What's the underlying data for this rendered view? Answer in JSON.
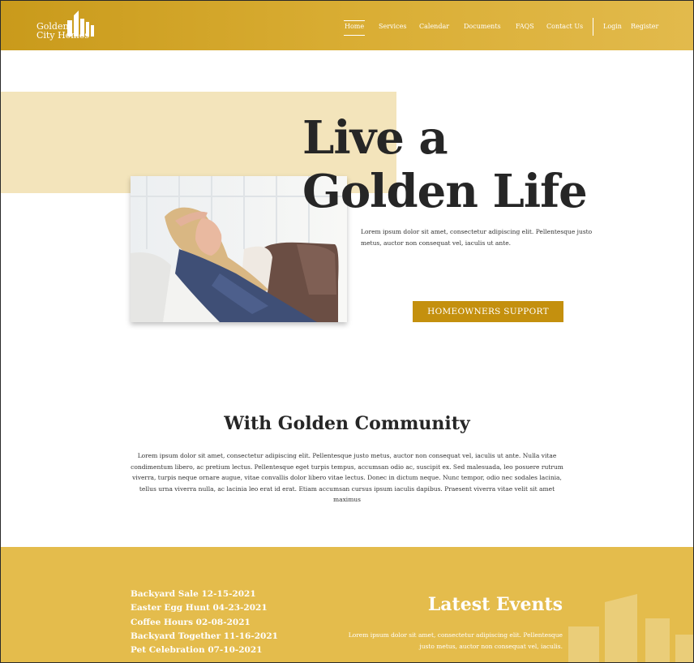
{
  "header": {
    "logo_line1": "Golden",
    "logo_line2": "City Homes",
    "nav": [
      "Home",
      "Services",
      "Calendar",
      "Documents",
      "FAQS",
      "Contact Us"
    ],
    "auth": [
      "Login",
      "Register"
    ]
  },
  "hero": {
    "title_line1": "Live a",
    "title_line2": "Golden Life",
    "text": "Lorem ipsum dolor sit amet, consectetur adipiscing elit. Pellentesque justo metus, auctor non consequat vel, iaculis ut ante.",
    "button": "HOMEOWNERS SUPPORT",
    "photo": "woman-relaxing-on-sofa"
  },
  "community": {
    "title": "With Golden Community",
    "text": "Lorem ipsum dolor sit amet, consectetur adipiscing elit. Pellentesque justo metus, auctor non consequat vel, iaculis ut ante. Nulla vitae condimentum libero, ac pretium lectus. Pellentesque eget turpis tempus, accumsan odio ac, suscipit ex. Sed malesuada, leo posuere rutrum viverra, turpis neque ornare augue, vitae convallis dolor libero vitae lectus. Donec in dictum neque. Nunc tempor, odio nec sodales lacinia, tellus urna viverra nulla, ac lacinia leo erat id erat. Etiam accumsan cursus ipsum iaculis dapibus. Praesent viverra vitae velit sit amet maximus"
  },
  "events": {
    "list": [
      "Backyard Sale 12-15-2021",
      "Easter Egg Hunt 04-23-2021",
      "Coffee Hours 02-08-2021",
      "Backyard Together 11-16-2021",
      "Pet Celebration 07-10-2021"
    ],
    "title": "Latest Events",
    "text": "Lorem ipsum dolor sit amet, consectetur adipiscing elit. Pellentesque justo metus, auctor non consequat vel, iaculis."
  },
  "colors": {
    "brand_gold": "#d9ad33",
    "button_gold": "#c4900e",
    "hero_block": "#f3e4bb",
    "events_bg": "#e4bc4c"
  }
}
